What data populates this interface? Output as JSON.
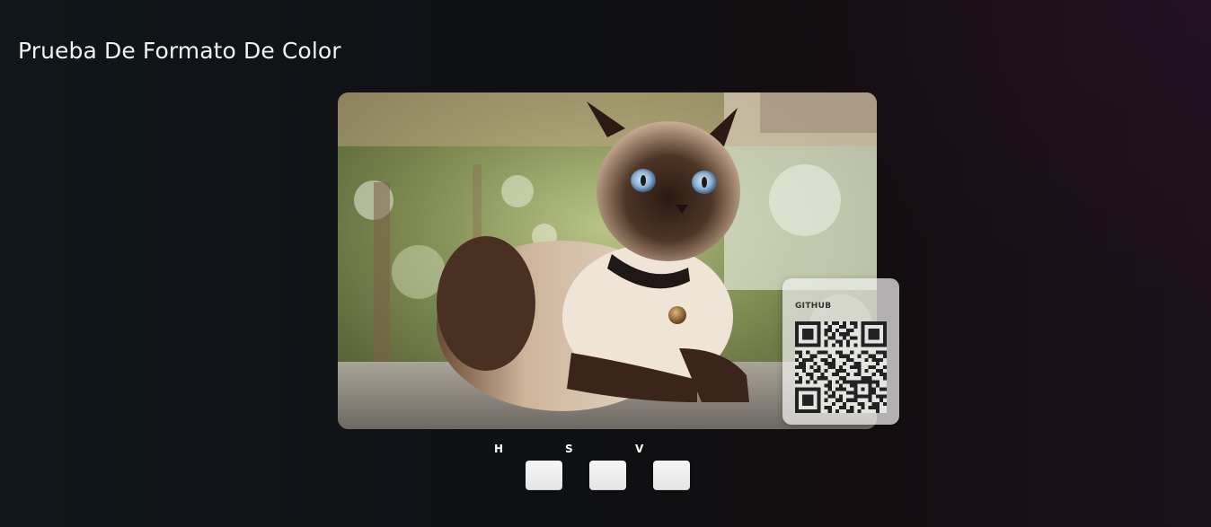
{
  "header": {
    "title": "Prueba De Formato De Color"
  },
  "image": {
    "subject": "siamese-cat-photo"
  },
  "qr_card": {
    "label": "GITHUB"
  },
  "hsv": {
    "labels": [
      "H",
      "S",
      "V"
    ]
  },
  "colors": {
    "background_left": "#11161a",
    "background_right": "#1b111b",
    "title_text": "#f2f2f2",
    "swatch": "#eeeeee"
  }
}
